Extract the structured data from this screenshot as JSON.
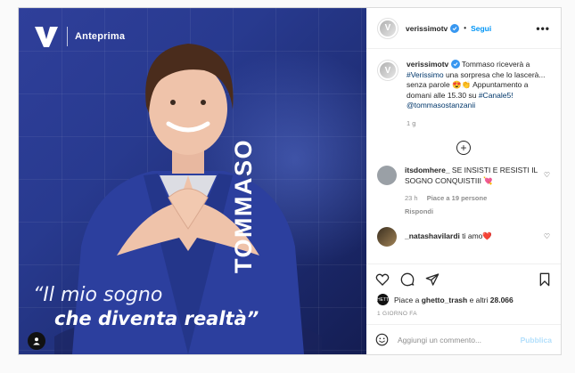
{
  "media": {
    "brand_label": "Anteprima",
    "vertical_name": "TOMMASO",
    "quote_line1": "“Il mio sogno",
    "quote_line2": "che diventa realtà”",
    "icons": [
      "veriissimo-v-logo",
      "person-tag-icon"
    ]
  },
  "header": {
    "username": "verissimotv",
    "follow_label": "Segui",
    "dot": "•",
    "more": "•••"
  },
  "caption": {
    "username": "verissimotv",
    "text_1": "Tommaso riceverà a",
    "hashtag_1": "#Verissimo",
    "text_2": "una sorpresa che lo lascerà... senza parole 😍👏 Appuntamento a domani alle 15.30 su",
    "hashtag_2": "#Canale5!",
    "mention": "@tommasostanzanii",
    "time": "1 g"
  },
  "comments": [
    {
      "username": "itsdomhere_",
      "text": "SE INSISTI E RESISTI IL SOGNO CONQUISTIII 💘",
      "time": "23 h",
      "likes": "Piace a 19 persone",
      "reply": "Rispondi",
      "avatar_color": "#9aa0a6"
    },
    {
      "username": "_natashavilardi",
      "text": "ti amo❤️",
      "avatar_color": "#6b5a3a"
    }
  ],
  "likes": {
    "prefix": "Piace a",
    "user": "ghetto_trash",
    "suffix": "e altri",
    "count": "28.066",
    "avatar_label": "GHETTO"
  },
  "timestamp": "1 GIORNO FA",
  "comment_box": {
    "placeholder": "Aggiungi un commento...",
    "publish_label": "Pubblica"
  },
  "colors": {
    "accent": "#0095f6",
    "publish_disabled": "#b2dffc",
    "media_bg": "#283a8f"
  }
}
